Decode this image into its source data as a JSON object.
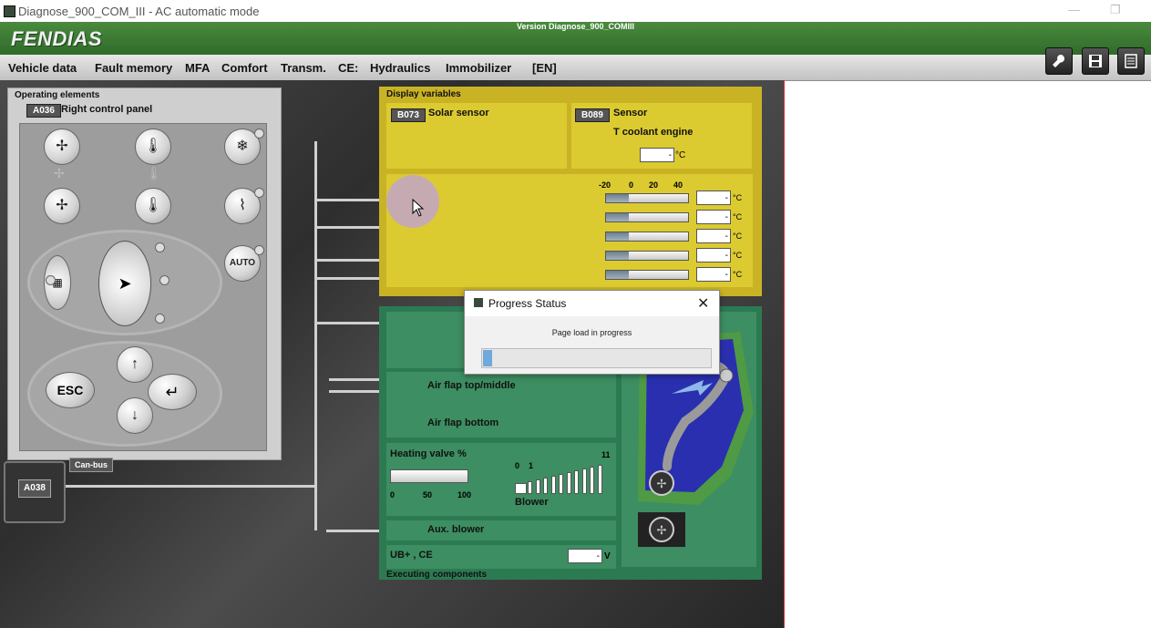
{
  "window": {
    "title": "Diagnose_900_COM_III - AC automatic mode",
    "minimize_glyph": "—",
    "restore_glyph": "❐"
  },
  "header": {
    "logo": "FENDIAS",
    "version": "Version Diagnose_900_COMIII"
  },
  "menu": {
    "items": [
      "Vehicle data",
      "Fault memory",
      "MFA",
      "Comfort",
      "Transm.",
      "CE:",
      "Hydraulics",
      "Immobilizer",
      "[EN]"
    ]
  },
  "toolbar": {
    "icons": [
      "wrench-icon",
      "save-icon",
      "list-icon"
    ]
  },
  "operating_elements": {
    "title": "Operating elements",
    "panel_badge": "A036",
    "panel_name": "Right control panel",
    "buttons": {
      "auto": "AUTO",
      "esc": "ESC"
    },
    "icons": [
      "fan-icon",
      "thermometer-icon",
      "snowflake-icon",
      "fan-small-icon",
      "thermometer-small-icon",
      "defrost-icon",
      "air-distribution-icon",
      "arrow-up-icon",
      "enter-icon",
      "arrow-down-icon"
    ]
  },
  "canbus": {
    "label": "Can-bus",
    "module": "A038"
  },
  "display_variables": {
    "title": "Display variables",
    "solar": {
      "badge": "B073",
      "label": "Solar sensor"
    },
    "sensor": {
      "badge": "B089",
      "label": "Sensor",
      "sublabel": "T coolant engine",
      "value": "-",
      "unit": "°C"
    },
    "scale": [
      "-20",
      "0",
      "20",
      "40"
    ],
    "temps": [
      {
        "value": "-",
        "unit": "°C",
        "fill": 0.28
      },
      {
        "value": "-",
        "unit": "°C",
        "fill": 0.28
      },
      {
        "value": "-",
        "unit": "°C",
        "fill": 0.28
      },
      {
        "value": "-",
        "unit": "°C",
        "fill": 0.28
      },
      {
        "value": "-",
        "unit": "°C",
        "fill": 0.28
      }
    ]
  },
  "executing_components": {
    "title": "Executing components",
    "air_flap_top": "Air flap top/middle",
    "air_flap_bottom": "Air flap bottom",
    "heating_valve": {
      "label": "Heating valve %",
      "scale": [
        "0",
        "50",
        "100"
      ],
      "level": 1.0
    },
    "blower": {
      "label": "Blower",
      "min": "0",
      "one": "1",
      "max": "11"
    },
    "aux_blower": "Aux. blower",
    "ub_ce": {
      "label": "UB+ , CE",
      "value": "-",
      "unit": "V"
    }
  },
  "dialog": {
    "title": "Progress Status",
    "message": "Page load in progress",
    "close": "✕",
    "progress": 0.04
  },
  "colors": {
    "header_green": "#3f7f35",
    "display_yellow": "#dcca31",
    "exec_green": "#3d8e62",
    "progress_blue": "#0b78d7"
  }
}
